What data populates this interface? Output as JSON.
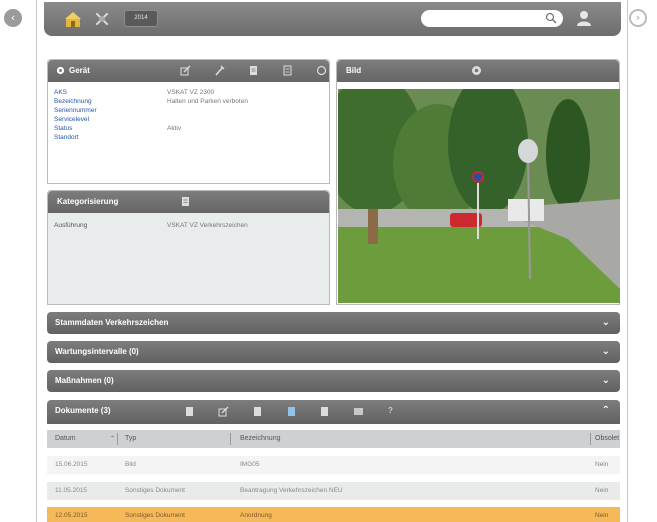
{
  "toolbar": {
    "year_tag": "2014",
    "search_placeholder": ""
  },
  "gerat": {
    "title": "Gerät",
    "fields": [
      {
        "label": "AKS",
        "value": "VSKAT VZ 2300"
      },
      {
        "label": "Bezeichnung",
        "value": "Halten und Parken verboten"
      },
      {
        "label": "Seriennummer",
        "value": ""
      },
      {
        "label": "Servicelevel",
        "value": ""
      },
      {
        "label": "Status",
        "value": "Aktiv"
      },
      {
        "label": "Standort",
        "value": ""
      }
    ]
  },
  "kategorisierung": {
    "title": "Kategorisierung",
    "fields": [
      {
        "label": "Ausführung",
        "value": "VSKAT VZ Verkehrszeichen"
      }
    ]
  },
  "bild": {
    "title": "Bild"
  },
  "sections": [
    {
      "label": "Stammdaten Verkehrszeichen"
    },
    {
      "label": "Wartungsintervalle (0)"
    },
    {
      "label": "Maßnahmen (0)"
    }
  ],
  "dokumente": {
    "title": "Dokumente (3)",
    "columns": [
      "Datum",
      "Typ",
      "Bezeichnung",
      "Obsolet"
    ],
    "rows": [
      {
        "date": "15.06.2015",
        "type": "Bild",
        "name": "IMG05",
        "obsolete": "Nein",
        "highlight": false
      },
      {
        "date": "11.05.2015",
        "type": "Sonstiges Dokument",
        "name": "Beantragung Verkehrszeichen NEU",
        "obsolete": "Nein",
        "highlight": false
      },
      {
        "date": "12.05.2015",
        "type": "Sonstiges Dokument",
        "name": "Anordnung",
        "obsolete": "Nein",
        "highlight": true
      }
    ]
  },
  "colors": {
    "header_gray": "#6d6d6d",
    "highlight_row": "#f5b95a",
    "link_blue": "#2456a4"
  }
}
